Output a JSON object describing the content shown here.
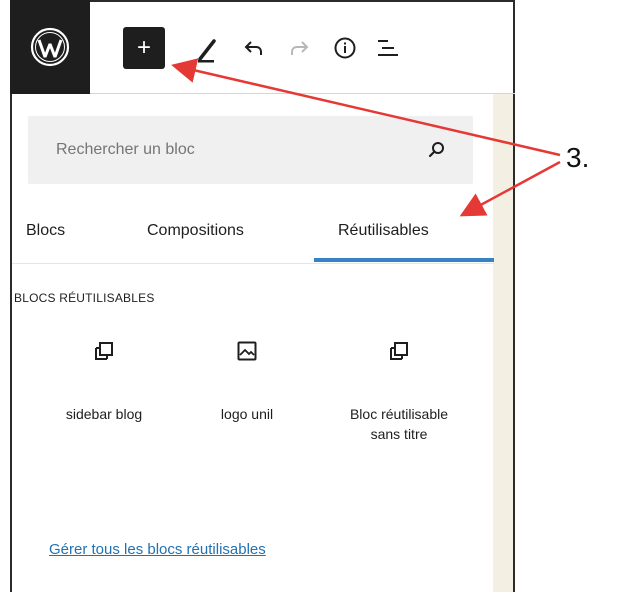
{
  "toolbar": {
    "logo_icon": "wordpress-logo-icon",
    "inserter_label": "+",
    "tools": [
      {
        "name": "pen-tool-icon"
      },
      {
        "name": "undo-icon"
      },
      {
        "name": "redo-icon"
      },
      {
        "name": "info-icon"
      },
      {
        "name": "list-view-icon"
      }
    ]
  },
  "search": {
    "placeholder": "Rechercher un bloc",
    "icon": "search-icon"
  },
  "tabs": [
    {
      "label": "Blocs",
      "active": false
    },
    {
      "label": "Compositions",
      "active": false
    },
    {
      "label": "Réutilisables",
      "active": true
    }
  ],
  "section": {
    "heading": "BLOCS RÉUTILISABLES"
  },
  "blocks": [
    {
      "label": "sidebar blog",
      "icon": "reusable-block-icon"
    },
    {
      "label": "logo unil",
      "icon": "image-icon"
    },
    {
      "label": "Bloc réutilisable sans titre",
      "icon": "reusable-block-icon"
    }
  ],
  "manage_link": "Gérer tous les blocs réutilisables",
  "annotation": {
    "label": "3.",
    "arrow_color": "#e53935"
  },
  "colors": {
    "accent": "#3582c4",
    "link": "#2271b1",
    "toolbar_dark": "#1e1e1e"
  }
}
